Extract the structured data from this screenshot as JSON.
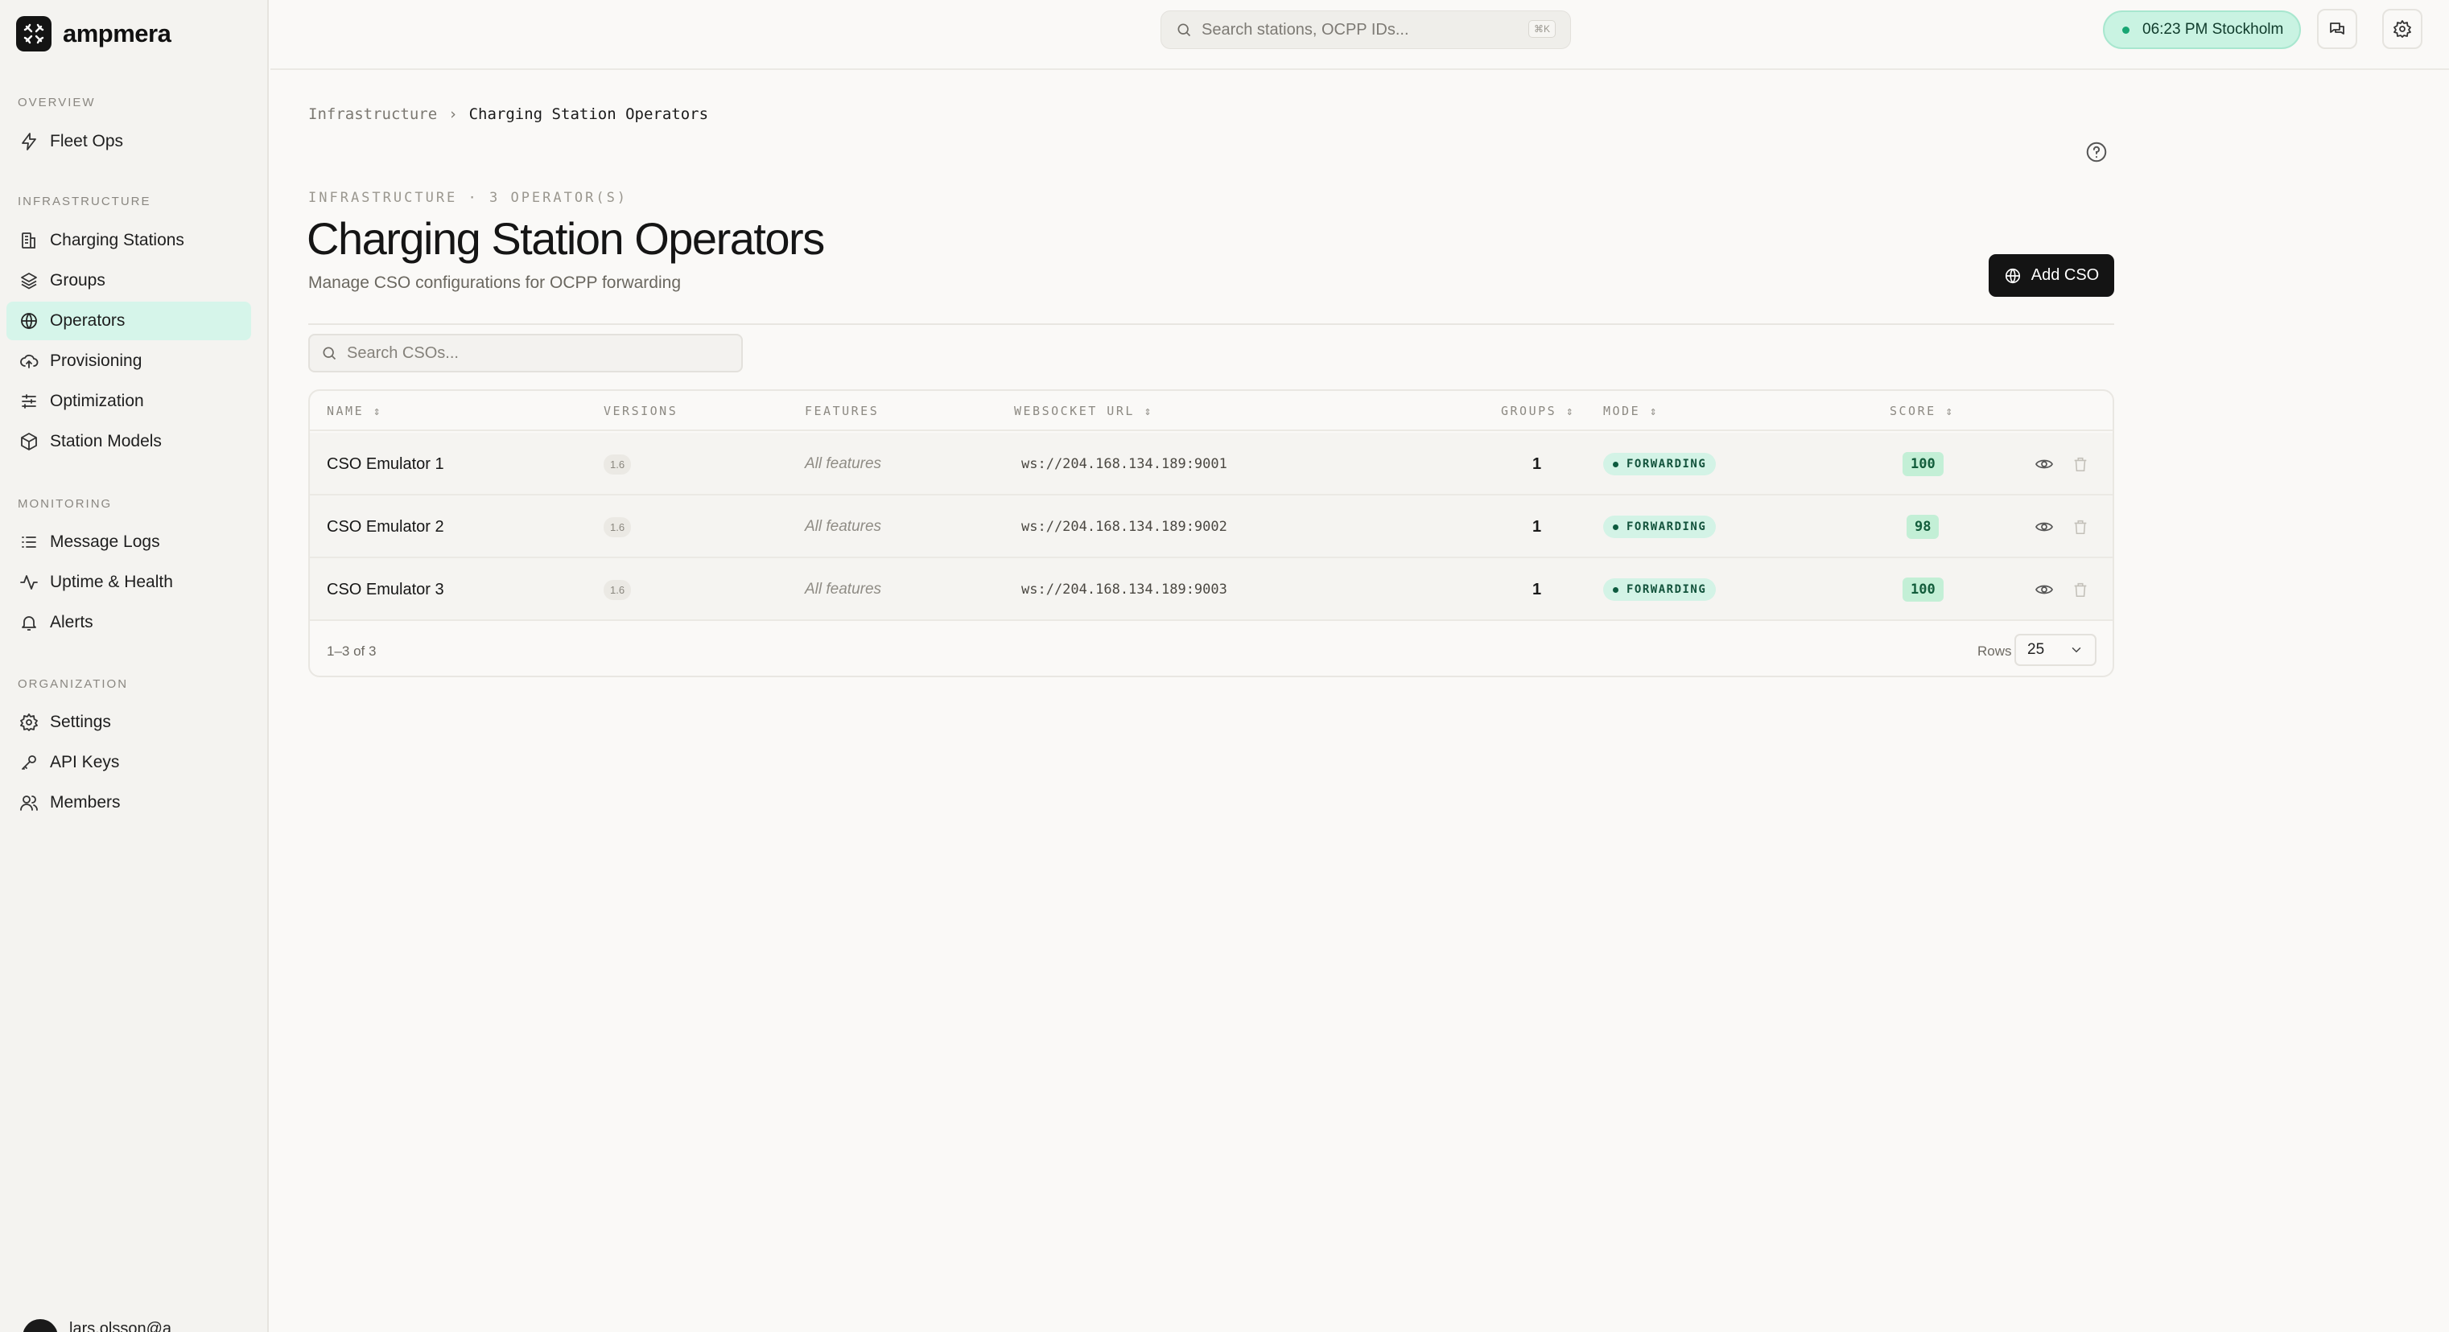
{
  "app": {
    "name": "ampmera"
  },
  "sidebar": {
    "sections": {
      "overview": "OVERVIEW",
      "infrastructure": "INFRASTRUCTURE",
      "monitoring": "MONITORING",
      "organization": "ORGANIZATION"
    },
    "items": [
      {
        "label": "Fleet Ops",
        "icon": "bolt-icon"
      },
      {
        "label": "Charging Stations",
        "icon": "building-icon"
      },
      {
        "label": "Groups",
        "icon": "layers-icon"
      },
      {
        "label": "Operators",
        "icon": "globe-icon",
        "active": true
      },
      {
        "label": "Provisioning",
        "icon": "cloud-upload-icon"
      },
      {
        "label": "Optimization",
        "icon": "sliders-icon"
      },
      {
        "label": "Station Models",
        "icon": "cube-icon"
      },
      {
        "label": "Message Logs",
        "icon": "list-icon"
      },
      {
        "label": "Uptime & Health",
        "icon": "activity-icon"
      },
      {
        "label": "Alerts",
        "icon": "bell-icon"
      },
      {
        "label": "Settings",
        "icon": "gear-icon"
      },
      {
        "label": "API Keys",
        "icon": "key-icon"
      },
      {
        "label": "Members",
        "icon": "users-icon"
      }
    ],
    "user": {
      "name": "lars.olsson@a"
    }
  },
  "topbar": {
    "search_placeholder": "Search stations, OCPP IDs...",
    "search_shortcut": "⌘K",
    "clock": "06:23 PM Stockholm"
  },
  "breadcrumb": {
    "parent": "Infrastructure",
    "separator": "›",
    "current": "Charging Station Operators"
  },
  "header": {
    "eyebrow": "INFRASTRUCTURE · 3 OPERATOR(S)",
    "title": "Charging Station Operators",
    "subtitle": "Manage CSO configurations for OCPP forwarding",
    "add_button": "Add CSO"
  },
  "table": {
    "search_placeholder": "Search CSOs...",
    "columns": {
      "name": "NAME",
      "versions": "VERSIONS",
      "features": "FEATURES",
      "websocket_url": "WEBSOCKET URL",
      "groups": "GROUPS",
      "mode": "MODE",
      "score": "SCORE",
      "sort_glyph": "⇕"
    },
    "rows": [
      {
        "name": "CSO Emulator 1",
        "version": "1.6",
        "features": "All features",
        "url": "ws://204.168.134.189:9001",
        "groups": "1",
        "mode": "FORWARDING",
        "score": "100"
      },
      {
        "name": "CSO Emulator 2",
        "version": "1.6",
        "features": "All features",
        "url": "ws://204.168.134.189:9002",
        "groups": "1",
        "mode": "FORWARDING",
        "score": "98"
      },
      {
        "name": "CSO Emulator 3",
        "version": "1.6",
        "features": "All features",
        "url": "ws://204.168.134.189:9003",
        "groups": "1",
        "mode": "FORWARDING",
        "score": "100"
      }
    ],
    "footer": {
      "range": "1–3 of 3",
      "rows_label": "Rows",
      "rows_value": "25"
    }
  },
  "colors": {
    "accent": "#d6f5ea",
    "primary_button": "#141414",
    "mode_badge": "#d3f3e6",
    "score_badge": "#c3efd6"
  }
}
